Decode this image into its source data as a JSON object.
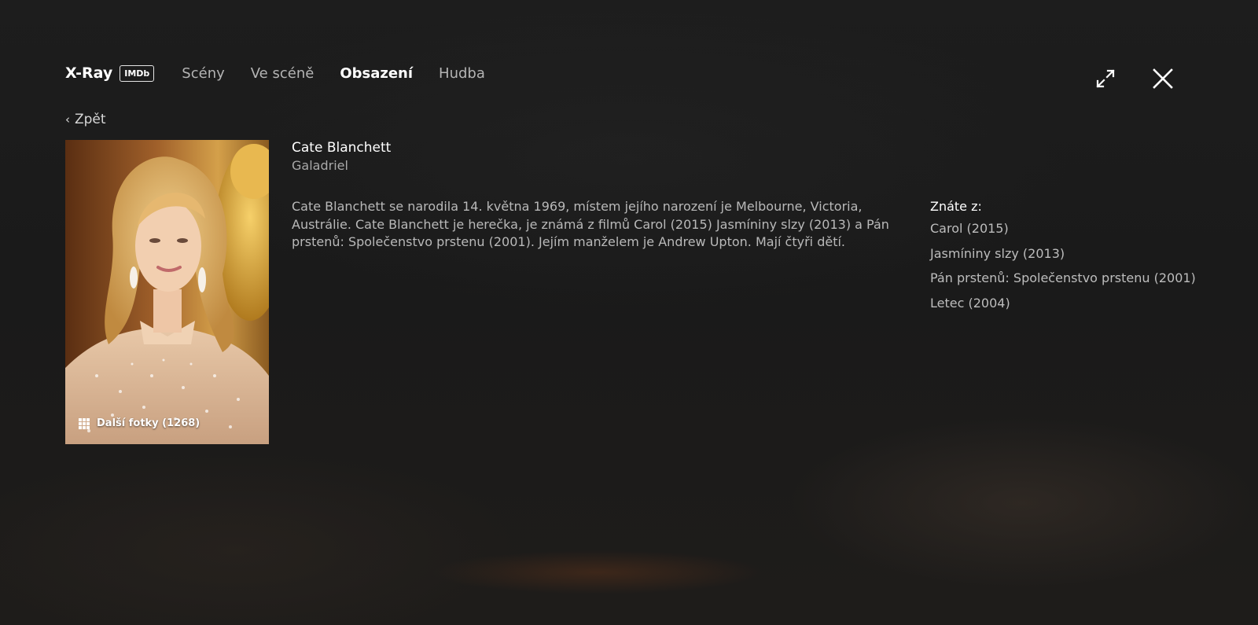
{
  "header": {
    "brand": "X-Ray",
    "badge": "IMDb",
    "tabs": [
      {
        "label": "Scény",
        "active": false
      },
      {
        "label": "Ve scéně",
        "active": false
      },
      {
        "label": "Obsazení",
        "active": true
      },
      {
        "label": "Hudba",
        "active": false
      }
    ]
  },
  "controls": {
    "expand_icon": "expand-arrows-icon",
    "close_icon": "close-x-icon"
  },
  "back": {
    "label": "Zpět"
  },
  "photo": {
    "more_label": "Další fotky (1268)",
    "icon": "grid-icon"
  },
  "actor": {
    "name": "Cate Blanchett",
    "character": "Galadriel",
    "bio": "Cate Blanchett se narodila 14. května 1969, místem jejího narození je Melbourne, Victoria, Austrálie. Cate Blanchett je herečka, je známá z filmů Carol (2015) Jasmíniny slzy (2013) a Pán prstenů: Společenstvo prstenu (2001). Jejím manželem je Andrew Upton. Mají čtyři dětí."
  },
  "known_for": {
    "heading": "Znáte z:",
    "items": [
      "Carol (2015)",
      "Jasmíniny slzy (2013)",
      "Pán prstenů: Společenstvo prstenu (2001)",
      "Letec (2004)"
    ]
  },
  "colors": {
    "background": "#1b1b1b",
    "text_primary": "#ffffff",
    "text_secondary": "#b4b4b4"
  }
}
